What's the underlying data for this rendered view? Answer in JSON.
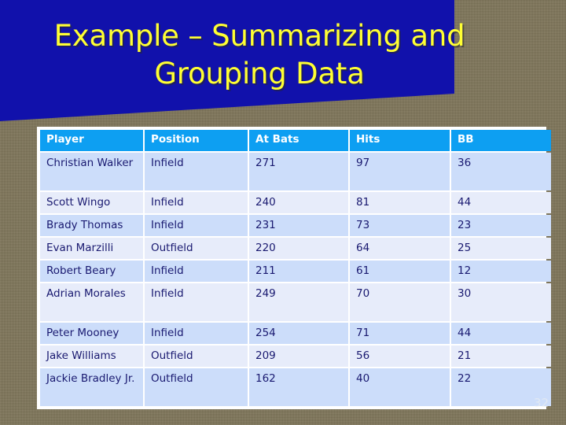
{
  "slide": {
    "background_color": "#7f7559",
    "banner_color": "#1111ab",
    "title_color": "#ffff33",
    "header_color": "#0d9ff2",
    "row_color_odd": "#ccddfa",
    "row_color_even": "#e7ecfa",
    "text_color": "#191970",
    "title": "Example – Summarizing and\nGrouping Data",
    "page_number": "32"
  },
  "table": {
    "columns": [
      "Player",
      "Position",
      "At Bats",
      "Hits",
      "BB"
    ],
    "rows": [
      {
        "player": "Christian Walker",
        "position": "Infield",
        "at_bats": "271",
        "hits": "97",
        "bb": "36"
      },
      {
        "player": "Scott Wingo",
        "position": "Infield",
        "at_bats": "240",
        "hits": "81",
        "bb": "44"
      },
      {
        "player": "Brady Thomas",
        "position": "Infield",
        "at_bats": "231",
        "hits": "73",
        "bb": "23"
      },
      {
        "player": "Evan Marzilli",
        "position": "Outfield",
        "at_bats": "220",
        "hits": "64",
        "bb": "25"
      },
      {
        "player": "Robert Beary",
        "position": "Infield",
        "at_bats": "211",
        "hits": "61",
        "bb": "12"
      },
      {
        "player": "Adrian Morales",
        "position": "Infield",
        "at_bats": "249",
        "hits": "70",
        "bb": "30"
      },
      {
        "player": "Peter Mooney",
        "position": "Infield",
        "at_bats": "254",
        "hits": "71",
        "bb": "44"
      },
      {
        "player": "Jake Williams",
        "position": "Outfield",
        "at_bats": "209",
        "hits": "56",
        "bb": "21"
      },
      {
        "player": "Jackie Bradley Jr.",
        "position": "Outfield",
        "at_bats": "162",
        "hits": "40",
        "bb": "22"
      }
    ]
  }
}
